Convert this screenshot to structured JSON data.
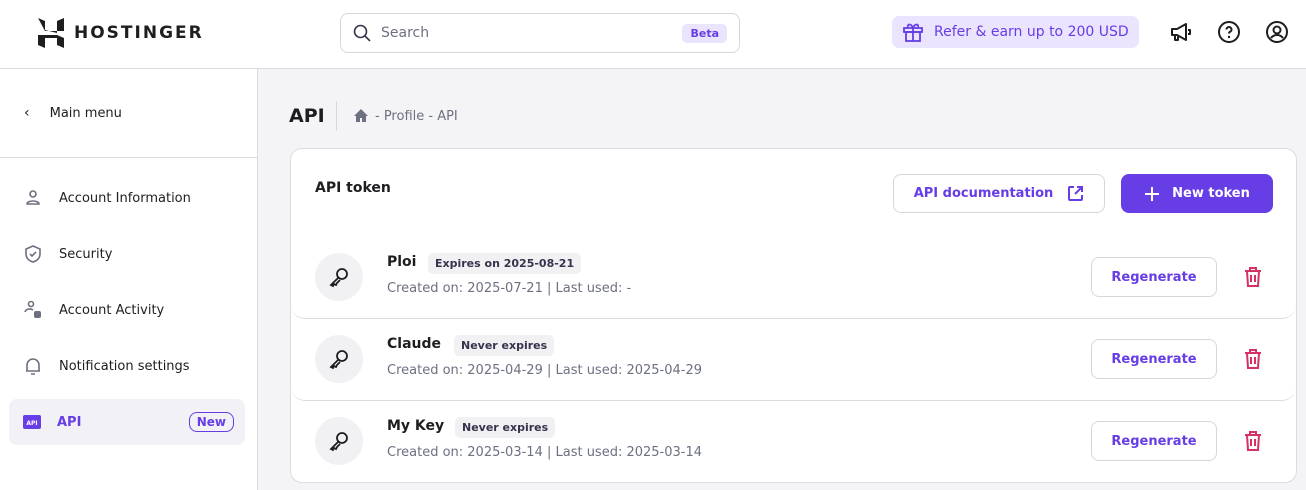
{
  "header": {
    "logo": "HOSTINGER",
    "search_placeholder": "Search",
    "search_badge": "Beta",
    "refer": "Refer & earn up to 200 USD"
  },
  "sidebar": {
    "main_menu": "Main menu",
    "items": [
      {
        "label": "Account Information",
        "icon": "user-icon"
      },
      {
        "label": "Security",
        "icon": "shield-icon"
      },
      {
        "label": "Account Activity",
        "icon": "activity-icon"
      },
      {
        "label": "Notification settings",
        "icon": "bell-icon"
      },
      {
        "label": "API",
        "icon": "api-icon",
        "badge": "New",
        "active": true
      }
    ]
  },
  "page": {
    "title": "API",
    "breadcrumb": "- Profile - API"
  },
  "card": {
    "title": "API token",
    "doc_button": "API documentation",
    "new_button": "New token",
    "tokens": [
      {
        "name": "Ploi",
        "badge": "Expires on 2025-08-21",
        "meta": "Created on: 2025-07-21 | Last used: -",
        "action": "Regenerate"
      },
      {
        "name": "Claude",
        "badge": "Never expires",
        "meta": "Created on: 2025-04-29 | Last used: 2025-04-29",
        "action": "Regenerate"
      },
      {
        "name": "My Key",
        "badge": "Never expires",
        "meta": "Created on: 2025-03-14 | Last used: 2025-03-14",
        "action": "Regenerate"
      }
    ]
  },
  "colors": {
    "accent": "#673de6",
    "danger": "#d63163"
  }
}
